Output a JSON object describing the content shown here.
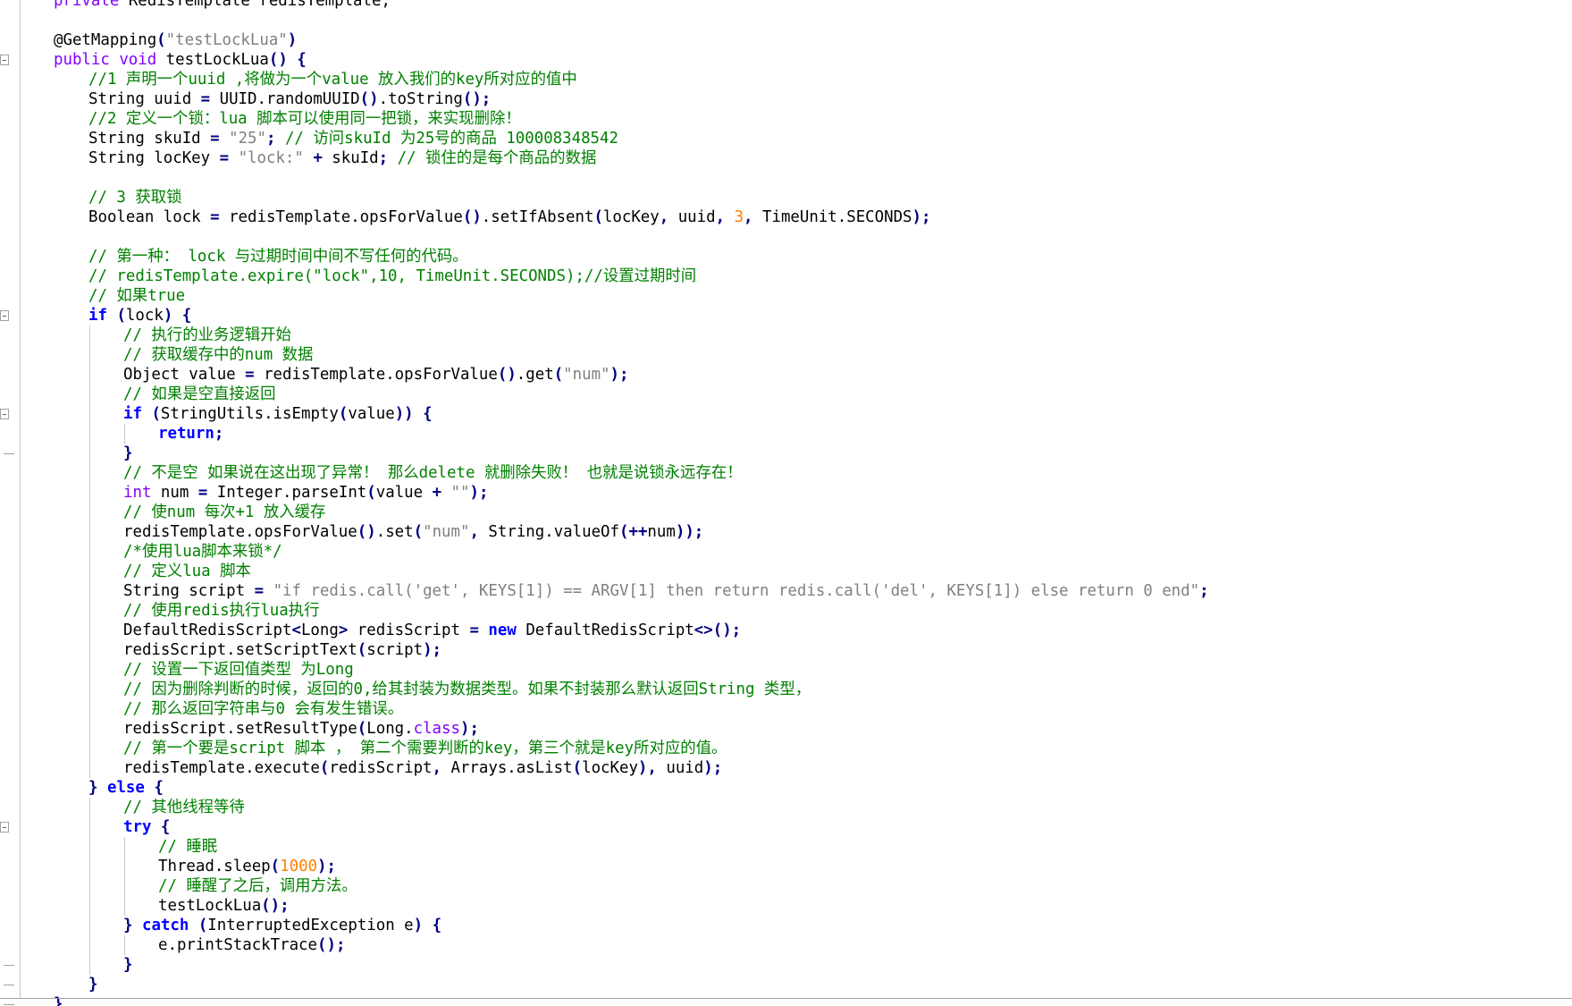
{
  "editor": {
    "name": "code-editor",
    "lines": [
      {
        "indent": 0,
        "tokens": [
          [
            "ty",
            "private"
          ],
          [
            "p",
            " RedisTemplate redisTemplate;"
          ]
        ]
      },
      {
        "indent": 0,
        "tokens": []
      },
      {
        "indent": 0,
        "tokens": [
          [
            "an",
            "@GetMapping"
          ],
          [
            "op",
            "("
          ],
          [
            "str",
            "\"testLockLua\""
          ],
          [
            "op",
            ")"
          ]
        ]
      },
      {
        "indent": 0,
        "fold": true,
        "tokens": [
          [
            "ty",
            "public"
          ],
          [
            "p",
            " "
          ],
          [
            "ty",
            "void"
          ],
          [
            "p",
            " testLockLua"
          ],
          [
            "op",
            "()"
          ],
          [
            "p",
            " "
          ],
          [
            "op",
            "{"
          ]
        ]
      },
      {
        "indent": 1,
        "tokens": [
          [
            "cm",
            "//1 声明一个uuid ,将做为一个value 放入我们的key所对应的值中"
          ]
        ]
      },
      {
        "indent": 1,
        "tokens": [
          [
            "p",
            "String uuid "
          ],
          [
            "op",
            "="
          ],
          [
            "p",
            " UUID.randomUUID"
          ],
          [
            "op",
            "()"
          ],
          [
            "p",
            ".toString"
          ],
          [
            "op",
            "();"
          ]
        ]
      },
      {
        "indent": 1,
        "tokens": [
          [
            "cm",
            "//2 定义一个锁：lua 脚本可以使用同一把锁，来实现删除！"
          ]
        ]
      },
      {
        "indent": 1,
        "tokens": [
          [
            "p",
            "String skuId "
          ],
          [
            "op",
            "="
          ],
          [
            "p",
            " "
          ],
          [
            "str",
            "\"25\""
          ],
          [
            "op",
            ";"
          ],
          [
            "p",
            " "
          ],
          [
            "cm",
            "// 访问skuId 为25号的商品 100008348542"
          ]
        ]
      },
      {
        "indent": 1,
        "tokens": [
          [
            "p",
            "String locKey "
          ],
          [
            "op",
            "="
          ],
          [
            "p",
            " "
          ],
          [
            "str",
            "\"lock:\""
          ],
          [
            "p",
            " "
          ],
          [
            "op",
            "+"
          ],
          [
            "p",
            " skuId"
          ],
          [
            "op",
            ";"
          ],
          [
            "p",
            " "
          ],
          [
            "cm",
            "// 锁住的是每个商品的数据"
          ]
        ]
      },
      {
        "indent": 1,
        "tokens": []
      },
      {
        "indent": 1,
        "tokens": [
          [
            "cm",
            "// 3 获取锁"
          ]
        ]
      },
      {
        "indent": 1,
        "tokens": [
          [
            "p",
            "Boolean lock "
          ],
          [
            "op",
            "="
          ],
          [
            "p",
            " redisTemplate.opsForValue"
          ],
          [
            "op",
            "()"
          ],
          [
            "p",
            ".setIfAbsent"
          ],
          [
            "op",
            "("
          ],
          [
            "p",
            "locKey"
          ],
          [
            "op",
            ","
          ],
          [
            "p",
            " uuid"
          ],
          [
            "op",
            ","
          ],
          [
            "p",
            " "
          ],
          [
            "num",
            "3"
          ],
          [
            "op",
            ","
          ],
          [
            "p",
            " TimeUnit.SECONDS"
          ],
          [
            "op",
            ");"
          ]
        ]
      },
      {
        "indent": 1,
        "tokens": []
      },
      {
        "indent": 1,
        "tokens": [
          [
            "cm",
            "// 第一种： lock 与过期时间中间不写任何的代码。"
          ]
        ]
      },
      {
        "indent": 1,
        "tokens": [
          [
            "cm",
            "// redisTemplate.expire(\"lock\",10, TimeUnit.SECONDS);//设置过期时间"
          ]
        ]
      },
      {
        "indent": 1,
        "tokens": [
          [
            "cm",
            "// 如果true"
          ]
        ]
      },
      {
        "indent": 1,
        "fold": true,
        "tokens": [
          [
            "kw",
            "if"
          ],
          [
            "p",
            " "
          ],
          [
            "op",
            "("
          ],
          [
            "p",
            "lock"
          ],
          [
            "op",
            ")"
          ],
          [
            "p",
            " "
          ],
          [
            "op",
            "{"
          ]
        ]
      },
      {
        "indent": 2,
        "tokens": [
          [
            "cm",
            "// 执行的业务逻辑开始"
          ]
        ]
      },
      {
        "indent": 2,
        "tokens": [
          [
            "cm",
            "// 获取缓存中的num 数据"
          ]
        ]
      },
      {
        "indent": 2,
        "tokens": [
          [
            "p",
            "Object value "
          ],
          [
            "op",
            "="
          ],
          [
            "p",
            " redisTemplate.opsForValue"
          ],
          [
            "op",
            "()"
          ],
          [
            "p",
            ".get"
          ],
          [
            "op",
            "("
          ],
          [
            "str",
            "\"num\""
          ],
          [
            "op",
            ");"
          ]
        ]
      },
      {
        "indent": 2,
        "tokens": [
          [
            "cm",
            "// 如果是空直接返回"
          ]
        ]
      },
      {
        "indent": 2,
        "fold": true,
        "tokens": [
          [
            "kw",
            "if"
          ],
          [
            "p",
            " "
          ],
          [
            "op",
            "("
          ],
          [
            "p",
            "StringUtils.isEmpty"
          ],
          [
            "op",
            "("
          ],
          [
            "p",
            "value"
          ],
          [
            "op",
            "))"
          ],
          [
            "p",
            " "
          ],
          [
            "op",
            "{"
          ]
        ]
      },
      {
        "indent": 3,
        "tokens": [
          [
            "kw",
            "return"
          ],
          [
            "op",
            ";"
          ]
        ]
      },
      {
        "indent": 2,
        "foldEnd": true,
        "tokens": [
          [
            "op",
            "}"
          ]
        ]
      },
      {
        "indent": 2,
        "tokens": [
          [
            "cm",
            "// 不是空 如果说在这出现了异常！ 那么delete 就删除失败！ 也就是说锁永远存在！"
          ]
        ]
      },
      {
        "indent": 2,
        "tokens": [
          [
            "ty",
            "int"
          ],
          [
            "p",
            " num "
          ],
          [
            "op",
            "="
          ],
          [
            "p",
            " Integer.parseInt"
          ],
          [
            "op",
            "("
          ],
          [
            "p",
            "value "
          ],
          [
            "op",
            "+"
          ],
          [
            "p",
            " "
          ],
          [
            "str",
            "\"\""
          ],
          [
            "op",
            ");"
          ]
        ]
      },
      {
        "indent": 2,
        "tokens": [
          [
            "cm",
            "// 使num 每次+1 放入缓存"
          ]
        ]
      },
      {
        "indent": 2,
        "tokens": [
          [
            "p",
            "redisTemplate.opsForValue"
          ],
          [
            "op",
            "()"
          ],
          [
            "p",
            ".set"
          ],
          [
            "op",
            "("
          ],
          [
            "str",
            "\"num\""
          ],
          [
            "op",
            ","
          ],
          [
            "p",
            " String.valueOf"
          ],
          [
            "op",
            "(++"
          ],
          [
            "p",
            "num"
          ],
          [
            "op",
            "));"
          ]
        ]
      },
      {
        "indent": 2,
        "tokens": [
          [
            "cm",
            "/*使用lua脚本来锁*/"
          ]
        ]
      },
      {
        "indent": 2,
        "tokens": [
          [
            "cm",
            "// 定义lua 脚本"
          ]
        ]
      },
      {
        "indent": 2,
        "tokens": [
          [
            "p",
            "String script "
          ],
          [
            "op",
            "="
          ],
          [
            "p",
            " "
          ],
          [
            "str",
            "\"if redis.call('get', KEYS[1]) == ARGV[1] then return redis.call('del', KEYS[1]) else return 0 end\""
          ],
          [
            "op",
            ";"
          ]
        ]
      },
      {
        "indent": 2,
        "tokens": [
          [
            "cm",
            "// 使用redis执行lua执行"
          ]
        ]
      },
      {
        "indent": 2,
        "tokens": [
          [
            "p",
            "DefaultRedisScript"
          ],
          [
            "op",
            "<"
          ],
          [
            "p",
            "Long"
          ],
          [
            "op",
            ">"
          ],
          [
            "p",
            " redisScript "
          ],
          [
            "op",
            "="
          ],
          [
            "p",
            " "
          ],
          [
            "kw",
            "new"
          ],
          [
            "p",
            " DefaultRedisScript"
          ],
          [
            "op",
            "<>();"
          ]
        ]
      },
      {
        "indent": 2,
        "tokens": [
          [
            "p",
            "redisScript.setScriptText"
          ],
          [
            "op",
            "("
          ],
          [
            "p",
            "script"
          ],
          [
            "op",
            ");"
          ]
        ]
      },
      {
        "indent": 2,
        "tokens": [
          [
            "cm",
            "// 设置一下返回值类型 为Long"
          ]
        ]
      },
      {
        "indent": 2,
        "tokens": [
          [
            "cm",
            "// 因为删除判断的时候，返回的0,给其封装为数据类型。如果不封装那么默认返回String 类型，"
          ]
        ]
      },
      {
        "indent": 2,
        "tokens": [
          [
            "cm",
            "// 那么返回字符串与0 会有发生错误。"
          ]
        ]
      },
      {
        "indent": 2,
        "tokens": [
          [
            "p",
            "redisScript.setResultType"
          ],
          [
            "op",
            "("
          ],
          [
            "p",
            "Long."
          ],
          [
            "ty",
            "class"
          ],
          [
            "op",
            ");"
          ]
        ]
      },
      {
        "indent": 2,
        "tokens": [
          [
            "cm",
            "// 第一个要是script 脚本 ， 第二个需要判断的key，第三个就是key所对应的值。"
          ]
        ]
      },
      {
        "indent": 2,
        "tokens": [
          [
            "p",
            "redisTemplate.execute"
          ],
          [
            "op",
            "("
          ],
          [
            "p",
            "redisScript"
          ],
          [
            "op",
            ","
          ],
          [
            "p",
            " Arrays.asList"
          ],
          [
            "op",
            "("
          ],
          [
            "p",
            "locKey"
          ],
          [
            "op",
            "),"
          ],
          [
            "p",
            " uuid"
          ],
          [
            "op",
            ");"
          ]
        ]
      },
      {
        "indent": 1,
        "tokens": [
          [
            "op",
            "}"
          ],
          [
            "p",
            " "
          ],
          [
            "kw",
            "else"
          ],
          [
            "p",
            " "
          ],
          [
            "op",
            "{"
          ]
        ]
      },
      {
        "indent": 2,
        "tokens": [
          [
            "cm",
            "// 其他线程等待"
          ]
        ]
      },
      {
        "indent": 2,
        "fold": true,
        "tokens": [
          [
            "kw",
            "try"
          ],
          [
            "p",
            " "
          ],
          [
            "op",
            "{"
          ]
        ]
      },
      {
        "indent": 3,
        "tokens": [
          [
            "cm",
            "// 睡眠"
          ]
        ]
      },
      {
        "indent": 3,
        "tokens": [
          [
            "p",
            "Thread.sleep"
          ],
          [
            "op",
            "("
          ],
          [
            "num",
            "1000"
          ],
          [
            "op",
            ");"
          ]
        ]
      },
      {
        "indent": 3,
        "tokens": [
          [
            "cm",
            "// 睡醒了之后，调用方法。"
          ]
        ]
      },
      {
        "indent": 3,
        "tokens": [
          [
            "p",
            "testLockLua"
          ],
          [
            "op",
            "();"
          ]
        ]
      },
      {
        "indent": 2,
        "tokens": [
          [
            "op",
            "}"
          ],
          [
            "p",
            " "
          ],
          [
            "kw",
            "catch"
          ],
          [
            "p",
            " "
          ],
          [
            "op",
            "("
          ],
          [
            "p",
            "InterruptedException e"
          ],
          [
            "op",
            ")"
          ],
          [
            "p",
            " "
          ],
          [
            "op",
            "{"
          ]
        ]
      },
      {
        "indent": 3,
        "tokens": [
          [
            "p",
            "e.printStackTrace"
          ],
          [
            "op",
            "();"
          ]
        ]
      },
      {
        "indent": 2,
        "foldEnd": true,
        "tokens": [
          [
            "op",
            "}"
          ]
        ]
      },
      {
        "indent": 1,
        "foldEnd": true,
        "tokens": [
          [
            "op",
            "}"
          ]
        ]
      },
      {
        "indent": 0,
        "foldEnd": true,
        "tokens": [
          [
            "op",
            "}"
          ]
        ]
      }
    ]
  }
}
